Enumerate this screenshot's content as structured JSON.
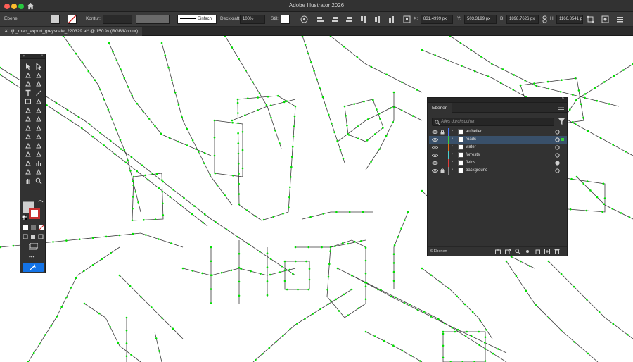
{
  "window": {
    "title": "Adobe Illustrator 2026",
    "traffic_colors": [
      "#ff5f57",
      "#febc2e",
      "#28c840"
    ]
  },
  "control_bar": {
    "selection_label": "Ebene",
    "stroke_label": "Kontur:",
    "stroke_style": "Einfach",
    "opacity_label": "Deckkraft:",
    "opacity_value": "100%",
    "style_label": "Stil:",
    "x_label": "X:",
    "x_value": "831,4999 px",
    "y_label": "Y:",
    "y_value": "503,3199 px",
    "w_label": "B:",
    "w_value": "1898,7626 px",
    "h_label": "H:",
    "h_value": "1166,8541 px"
  },
  "document_tab": {
    "title": "tjh_map_export_greyscale_220329.ai* @ 150 % (RGB/Kontur)"
  },
  "tools_panel": {
    "edit_toolbar_label": "•••",
    "icons": [
      "selection-tool",
      "direct-selection-tool",
      "magic-wand-tool",
      "lasso-tool",
      "pen-tool",
      "curvature-tool",
      "type-tool",
      "line-segment-tool",
      "rectangle-tool",
      "paintbrush-tool",
      "shaper-tool",
      "eraser-tool",
      "rotate-tool",
      "scale-tool",
      "width-tool",
      "free-transform-tool",
      "shape-builder-tool",
      "perspective-grid-tool",
      "mesh-tool",
      "gradient-tool",
      "eyedropper-tool",
      "blend-tool",
      "symbol-sprayer-tool",
      "column-graph-tool",
      "artboard-tool",
      "slice-tool",
      "hand-tool",
      "zoom-tool"
    ]
  },
  "layers_panel": {
    "tab_label": "Ebenen",
    "search_placeholder": "Alles durchsuchen",
    "count_label": "6 Ebenen",
    "layers": [
      {
        "name": "aufheller",
        "color": "#4a78ff",
        "locked": true,
        "selected": false
      },
      {
        "name": "roads",
        "color": "#3bd23b",
        "locked": false,
        "selected": true
      },
      {
        "name": "water",
        "color": "#e36b14",
        "locked": false,
        "selected": false
      },
      {
        "name": "forrests",
        "color": "#4bd0d0",
        "locked": false,
        "selected": false
      },
      {
        "name": "fields",
        "color": "#e23a3a",
        "locked": false,
        "selected": false
      },
      {
        "name": "background",
        "color": "#8a8a8a",
        "locked": true,
        "selected": false
      }
    ]
  },
  "colors": {
    "path_accent": "#00e000",
    "panel_bg": "#323232",
    "selection_blue": "#1473e6"
  }
}
